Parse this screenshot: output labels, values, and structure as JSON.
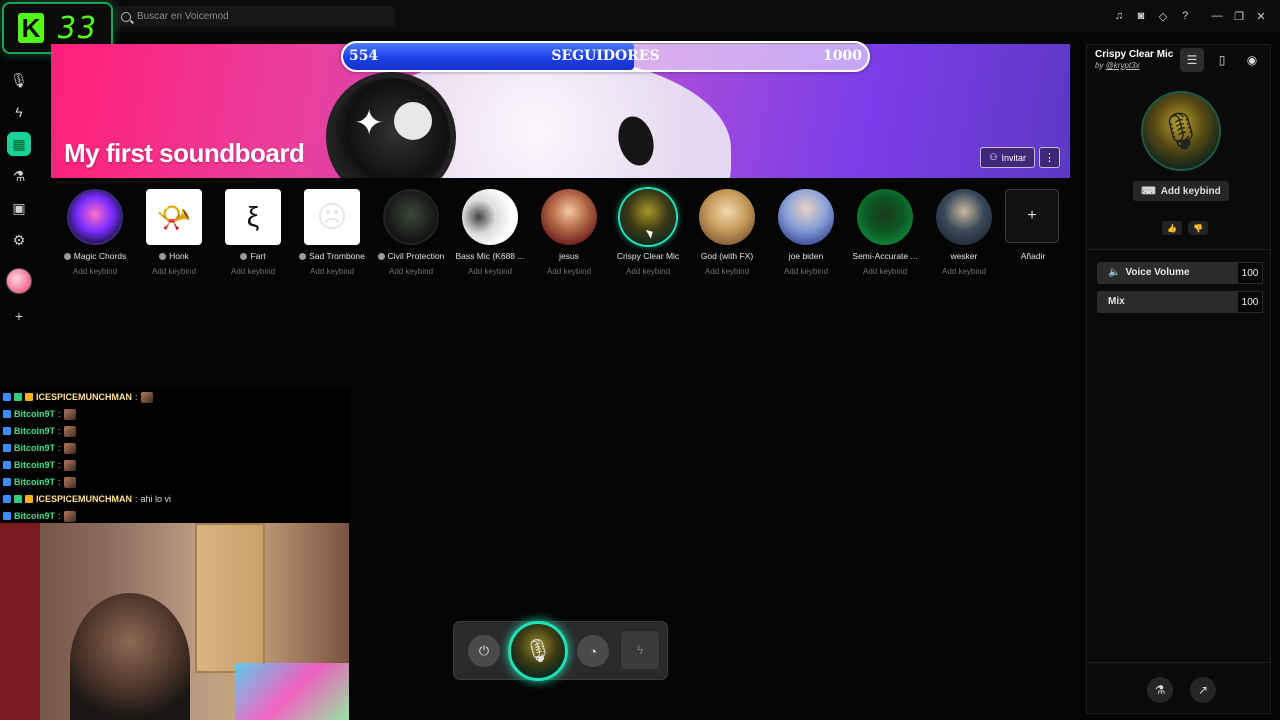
{
  "search": {
    "placeholder": "Buscar en Voicemod"
  },
  "titlebar_icons": [
    "bell-icon",
    "discord-icon",
    "diamond-icon",
    "help-icon",
    "minimize-icon",
    "maximize-icon",
    "close-icon"
  ],
  "titlebar": {
    "help": "?",
    "minimize": "—",
    "maximize": "❐",
    "close": "✕"
  },
  "badge": {
    "k": "K",
    "number": "33"
  },
  "soundboard": {
    "title": "My first soundboard",
    "invite_label": "Invitar",
    "more_label": "⋮"
  },
  "followers": {
    "current": "554",
    "label": "SEGUIDORES",
    "goal": "1000",
    "progress": 0.554
  },
  "tiles": [
    {
      "name": "Magic Chords",
      "keybind": "Add keybind",
      "has_dot": true
    },
    {
      "name": "Honk",
      "keybind": "Add keybind",
      "has_dot": true
    },
    {
      "name": "Fart",
      "keybind": "Add keybind",
      "has_dot": true
    },
    {
      "name": "Sad Trombone",
      "keybind": "Add keybind",
      "has_dot": true
    },
    {
      "name": "Civil Protection",
      "keybind": "Add keybind",
      "has_dot": true
    },
    {
      "name": "Bass Mic (K688 ...",
      "keybind": "Add keybind",
      "has_dot": false
    },
    {
      "name": "jesus",
      "keybind": "Add keybind",
      "has_dot": false
    },
    {
      "name": "Crispy Clear Mic",
      "keybind": "Add keybind",
      "has_dot": false,
      "selected": true
    },
    {
      "name": "God (with FX)",
      "keybind": "Add keybind",
      "has_dot": false
    },
    {
      "name": "joe biden",
      "keybind": "Add keybind",
      "has_dot": false
    },
    {
      "name": "Semi-Accurate ...",
      "keybind": "Add keybind",
      "has_dot": false
    },
    {
      "name": "wesker",
      "keybind": "Add keybind",
      "has_dot": false
    }
  ],
  "add_tile": {
    "label": "Añadir",
    "glyph": "+"
  },
  "chat": [
    {
      "user": "ICESPICEMUNCHMAN",
      "color": "#ffe38a",
      "msg": "",
      "badges": 3
    },
    {
      "user": "Bitcoin9T",
      "color": "#3fe08a",
      "msg": "",
      "badges": 1
    },
    {
      "user": "Bitcoin9T",
      "color": "#3fe08a",
      "msg": "",
      "badges": 1
    },
    {
      "user": "Bitcoin9T",
      "color": "#3fe08a",
      "msg": "",
      "badges": 1
    },
    {
      "user": "Bitcoin9T",
      "color": "#3fe08a",
      "msg": "",
      "badges": 1
    },
    {
      "user": "Bitcoin9T",
      "color": "#3fe08a",
      "msg": "",
      "badges": 1
    },
    {
      "user": "ICESPICEMUNCHMAN",
      "color": "#ffe38a",
      "msg": "ahi lo vi",
      "badges": 3
    },
    {
      "user": "Bitcoin9T",
      "color": "#3fe08a",
      "msg": "",
      "badges": 1
    }
  ],
  "voice": {
    "name": "Crispy Clear Mic",
    "author_prefix": "by ",
    "author": "@krypt3x",
    "add_keybind": "Add keybind",
    "volume_label": "Voice Volume",
    "volume_value": "100",
    "mix_label": "Mix",
    "mix_value": "100"
  },
  "colors": {
    "accent": "#22e0b6",
    "kick_green": "#53fc18",
    "follow_blue": "#1c3fe6"
  }
}
